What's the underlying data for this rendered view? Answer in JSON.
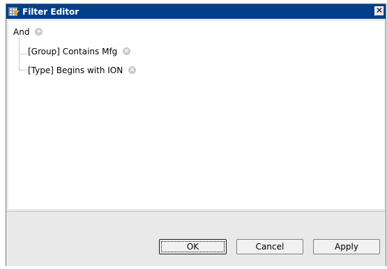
{
  "window": {
    "title": "Filter Editor",
    "close_label": "✕"
  },
  "tree": {
    "root_operator": "And",
    "conditions": [
      {
        "label": "[Group] Contains Mfg"
      },
      {
        "label": "[Type] Begins with ION"
      }
    ]
  },
  "buttons": {
    "ok": "OK",
    "cancel": "Cancel",
    "apply": "Apply"
  },
  "icons": {
    "add": "+",
    "remove": "×"
  },
  "colors": {
    "titlebar": "#003f8a",
    "title_text": "#ffffff",
    "dialog_bg": "#e9e9e9",
    "tree_bg": "#ffffff"
  }
}
